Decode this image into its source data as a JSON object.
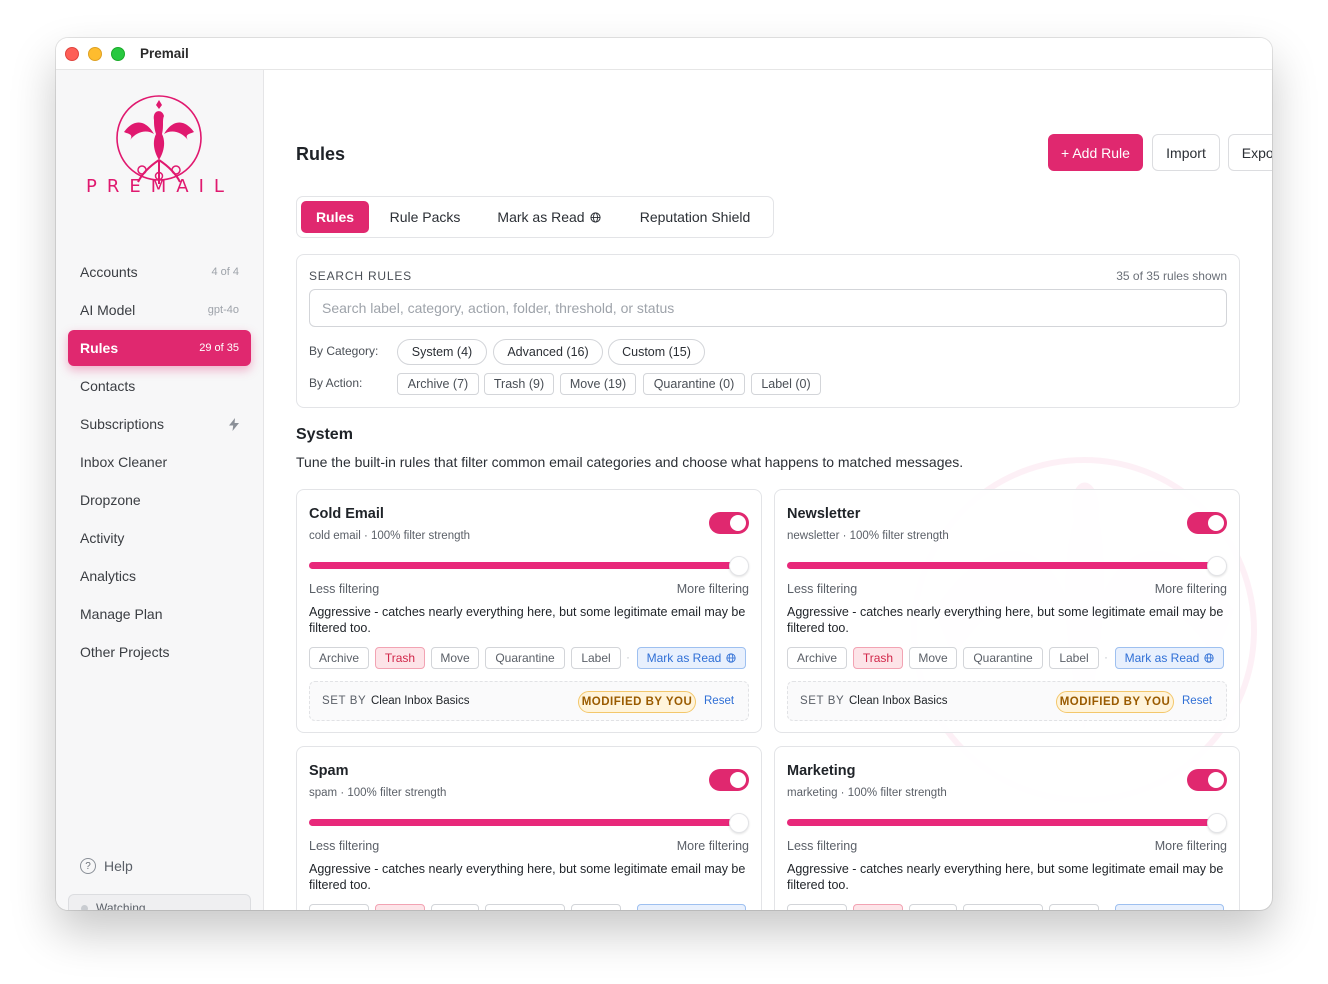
{
  "window": {
    "title": "Premail"
  },
  "sidebar": {
    "brand": "PREMAIL",
    "items": [
      {
        "label": "Accounts",
        "badge": "4 of 4"
      },
      {
        "label": "AI Model",
        "badge": "gpt-4o"
      },
      {
        "label": "Rules",
        "badge": "29 of 35",
        "active": true
      },
      {
        "label": "Contacts",
        "badge": ""
      },
      {
        "label": "Subscriptions",
        "badge": "",
        "icon": "bolt-icon"
      },
      {
        "label": "Inbox Cleaner",
        "badge": ""
      },
      {
        "label": "Dropzone",
        "badge": ""
      },
      {
        "label": "Activity",
        "badge": ""
      },
      {
        "label": "Analytics",
        "badge": ""
      },
      {
        "label": "Manage Plan",
        "badge": ""
      },
      {
        "label": "Other Projects",
        "badge": ""
      }
    ],
    "help": "Help",
    "status": "Watching"
  },
  "header": {
    "title": "Rules",
    "add_rule": "+ Add Rule",
    "import": "Import",
    "export": "Export"
  },
  "tabs": [
    {
      "label": "Rules",
      "active": true
    },
    {
      "label": "Rule Packs"
    },
    {
      "label": "Mark as Read",
      "icon": "globe-icon"
    },
    {
      "label": "Reputation Shield"
    }
  ],
  "search": {
    "label": "SEARCH RULES",
    "count": "35 of 35 rules shown",
    "placeholder": "Search label, category, action, folder, threshold, or status",
    "value": ""
  },
  "filters": {
    "category_label": "By Category:",
    "categories": [
      "System (4)",
      "Advanced (16)",
      "Custom (15)"
    ],
    "action_label": "By Action:",
    "actions": [
      "Archive (7)",
      "Trash (9)",
      "Move (19)",
      "Quarantine (0)",
      "Label (0)"
    ]
  },
  "section": {
    "title": "System",
    "description": "Tune the built-in rules that filter common email categories and choose what happens to matched messages."
  },
  "colors": {
    "accent": "#e0286f",
    "selected_action": "#fde4e8",
    "mark_as_read": "#e8f0fd",
    "modified_badge": "#fff4db"
  },
  "card_common": {
    "less": "Less filtering",
    "more": "More filtering",
    "actions": [
      "Archive",
      "Trash",
      "Move",
      "Quarantine",
      "Label"
    ],
    "mark_as_read": "Mark as Read",
    "set_by_label": "SET BY",
    "modified": "MODIFIED BY YOU",
    "reset": "Reset"
  },
  "cards": [
    {
      "title": "Cold Email",
      "subtitle": "cold email · 100% filter strength",
      "enabled": true,
      "strength": 1.0,
      "description": "Aggressive - catches nearly everything here, but some legitimate email may be filtered too.",
      "selected_action": "Trash",
      "set_by": "Clean Inbox Basics"
    },
    {
      "title": "Newsletter",
      "subtitle": "newsletter · 100% filter strength",
      "enabled": true,
      "strength": 1.0,
      "description": "Aggressive - catches nearly everything here, but some legitimate email may be filtered too.",
      "selected_action": "Trash",
      "set_by": "Clean Inbox Basics"
    },
    {
      "title": "Spam",
      "subtitle": "spam · 100% filter strength",
      "enabled": true,
      "strength": 1.0,
      "description": "Aggressive - catches nearly everything here, but some legitimate email may be filtered too.",
      "selected_action": "Trash",
      "set_by": ""
    },
    {
      "title": "Marketing",
      "subtitle": "marketing · 100% filter strength",
      "enabled": true,
      "strength": 1.0,
      "description": "Aggressive - catches nearly everything here, but some legitimate email may be filtered too.",
      "selected_action": "Trash",
      "set_by": ""
    }
  ]
}
